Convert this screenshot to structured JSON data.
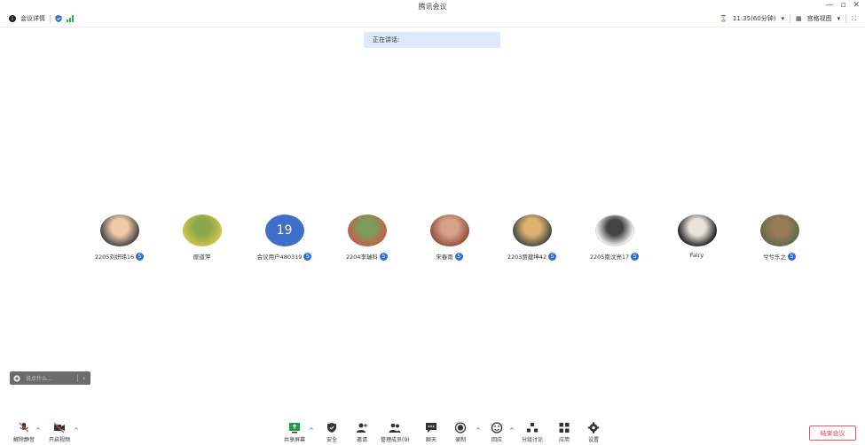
{
  "window": {
    "title": "腾讯会议",
    "minimize": "—",
    "restore": "▫",
    "close": "✕"
  },
  "toolbar": {
    "meeting_info": "会议详情",
    "timer": "11:35(60分钟)",
    "view": "宫格视图"
  },
  "speaking": {
    "label": "正在讲话:"
  },
  "participants": [
    {
      "name": "2205刘妍玮16",
      "type": "photo",
      "badge": "5",
      "colors": [
        "#3a3a3a",
        "#f0c9a8"
      ]
    },
    {
      "name": "原道萍",
      "type": "photo",
      "badge": "",
      "colors": [
        "#d6c34b",
        "#8aa84a"
      ]
    },
    {
      "name": "会议用户480319",
      "type": "number",
      "number": "19",
      "badge": "5",
      "colors": [
        "#3f6fca"
      ]
    },
    {
      "name": "2204李瑞科",
      "type": "photo",
      "badge": "5",
      "colors": [
        "#c95a4a",
        "#7c9c5a"
      ]
    },
    {
      "name": "宋春雨",
      "type": "photo",
      "badge": "5",
      "colors": [
        "#8a4c3a",
        "#d9a089"
      ]
    },
    {
      "name": "2203贾建坤42",
      "type": "photo",
      "badge": "5",
      "colors": [
        "#3c4640",
        "#e0b070"
      ]
    },
    {
      "name": "2205南汶亮17",
      "type": "photo",
      "badge": "5",
      "colors": [
        "#ffffff",
        "#444444"
      ]
    },
    {
      "name": "Fairy",
      "type": "photo",
      "badge": "",
      "colors": [
        "#141414",
        "#e9e2da"
      ]
    },
    {
      "name": "兮兮乐之",
      "type": "photo",
      "badge": "5",
      "colors": [
        "#5d6a48",
        "#9a7a5a"
      ]
    }
  ],
  "chat": {
    "placeholder": "说点什么..."
  },
  "bottom": {
    "unmute": "解除静音",
    "video": "开启视频",
    "share": "共享屏幕",
    "security": "安全",
    "invite": "邀请",
    "members": "管理成员(9)",
    "chat": "聊天",
    "record": "录制",
    "reaction": "回应",
    "breakout": "分组讨论",
    "apps": "应用",
    "settings": "设置",
    "end": "结束会议"
  },
  "colors": {
    "accent": "#3f6fca",
    "badge": "#2f6fd8",
    "end": "#e04848",
    "signal": "#2fb14a"
  }
}
